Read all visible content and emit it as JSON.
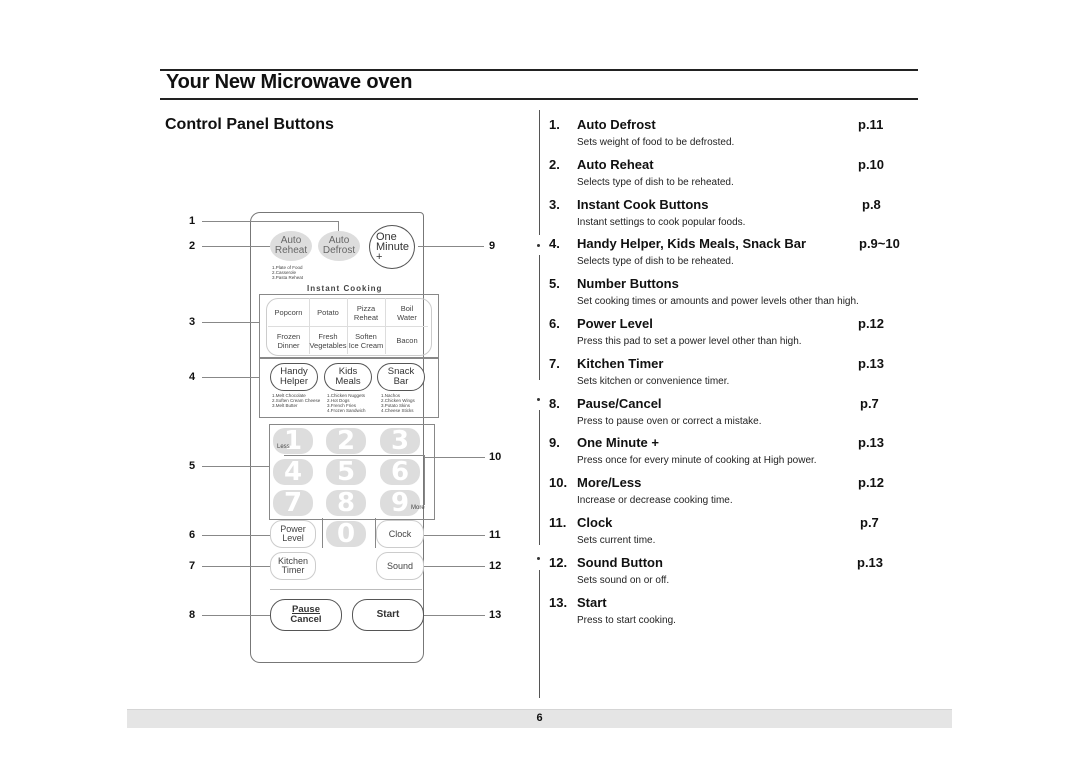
{
  "header": {
    "title": "Your New Microwave oven",
    "subtitle": "Control Panel Buttons"
  },
  "diagram": {
    "callouts": [
      "1",
      "2",
      "3",
      "4",
      "5",
      "6",
      "7",
      "8",
      "9",
      "10",
      "11",
      "12",
      "13"
    ],
    "buttons": {
      "auto_reheat": [
        "Auto",
        "Reheat"
      ],
      "auto_defrost": [
        "Auto",
        "Defrost"
      ],
      "one_minute": [
        "One",
        "Minute",
        "+"
      ],
      "reheat_list": [
        "1.Plate of Food",
        "2.Casserole",
        "3.Pasta Reheat"
      ],
      "instant_cooking_label": "Instant Cooking",
      "instant": [
        [
          "Popcorn"
        ],
        [
          "Potato"
        ],
        [
          "Pizza",
          "Reheat"
        ],
        [
          "Boil",
          "Water"
        ],
        [
          "Frozen",
          "Dinner"
        ],
        [
          "Fresh",
          "Vegetables"
        ],
        [
          "Soften",
          "Ice Cream"
        ],
        [
          "Bacon"
        ]
      ],
      "handy_helper": [
        "Handy",
        "Helper"
      ],
      "kids_meals": [
        "Kids",
        "Meals"
      ],
      "snack_bar": [
        "Snack",
        "Bar"
      ],
      "handy_list": [
        "1.Melt Chocolate",
        "2.Soften Cream Cheese",
        "3.Melt Butter"
      ],
      "kids_list": [
        "1.Chicken Nuggets",
        "2.Hot Dogs",
        "3.French Fries",
        "4.Frozen Sandwich"
      ],
      "snack_list": [
        "1.Nachos",
        "2.Chicken Wings",
        "3.Potato Skins",
        "4.Cheese Sticks"
      ],
      "numbers": [
        "1",
        "2",
        "3",
        "4",
        "5",
        "6",
        "7",
        "8",
        "9",
        "0"
      ],
      "less": "Less",
      "more": "More",
      "power_level": [
        "Power",
        "Level"
      ],
      "clock": "Clock",
      "kitchen_timer": [
        "Kitchen",
        "Timer"
      ],
      "sound": "Sound",
      "pause_cancel": [
        "Pause",
        "Cancel"
      ],
      "start": "Start"
    }
  },
  "items": [
    {
      "num": "1.",
      "title": "Auto Defrost",
      "page": "p.11",
      "desc": "Sets weight of food to be defrosted."
    },
    {
      "num": "2.",
      "title": "Auto Reheat",
      "page": "p.10",
      "desc": "Selects type of dish to be reheated."
    },
    {
      "num": "3.",
      "title": "Instant Cook Buttons",
      "page": "p.8",
      "desc": "Instant settings to cook popular foods."
    },
    {
      "num": "4.",
      "title": "Handy Helper, Kids Meals, Snack Bar",
      "page": "p.9~10",
      "desc": "Selects type of dish to be reheated."
    },
    {
      "num": "5.",
      "title": "Number Buttons",
      "page": "",
      "desc": "Set cooking times or amounts and power levels other than high."
    },
    {
      "num": "6.",
      "title": "Power Level",
      "page": "p.12",
      "desc": "Press this pad to set a power level other than high."
    },
    {
      "num": "7.",
      "title": "Kitchen Timer",
      "page": "p.13",
      "desc": "Sets kitchen or convenience timer."
    },
    {
      "num": "8.",
      "title": "Pause/Cancel",
      "page": "p.7",
      "desc": "Press to pause oven or correct a mistake."
    },
    {
      "num": "9.",
      "title": "One Minute +",
      "page": "p.13",
      "desc": "Press once for every minute of cooking at High power."
    },
    {
      "num": "10.",
      "title": "More/Less",
      "page": "p.12",
      "desc": "Increase or decrease cooking time."
    },
    {
      "num": "11.",
      "title": "Clock",
      "page": "p.7",
      "desc": "Sets current time."
    },
    {
      "num": "12.",
      "title": "Sound Button",
      "page": "p.13",
      "desc": "Sets sound on or off."
    },
    {
      "num": "13.",
      "title": "Start",
      "page": "",
      "desc": "Press to start cooking."
    }
  ],
  "footer": {
    "page_number": "6"
  }
}
